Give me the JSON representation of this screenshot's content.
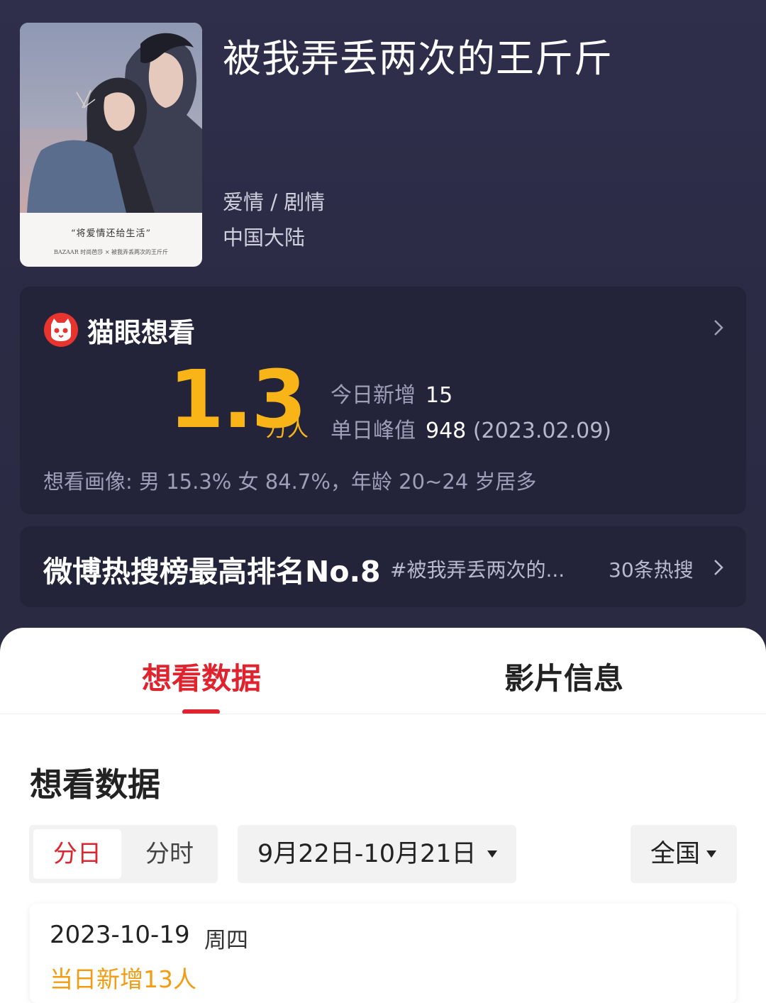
{
  "movie": {
    "title": "被我弄丢两次的王斤斤",
    "genre": "爱情 / 剧情",
    "region": "中国大陆",
    "poster": {
      "caption": "“将爱情还给生活”",
      "logos": "BAZAAR 时尚芭莎 × 被我弄丢两次的王斤斤"
    }
  },
  "want_card": {
    "title": "猫眼想看",
    "total_value": "1.3",
    "total_unit": "万人",
    "today_label": "今日新增",
    "today_value": "15",
    "peak_label": "单日峰值",
    "peak_value": "948",
    "peak_date": "(2023.02.09)",
    "portrait": "想看画像: 男 15.3%  女 84.7%，年龄 20~24 岁居多"
  },
  "weibo": {
    "rank_text": "微博热搜榜最高排名No.8",
    "tag": "#被我弄丢两次的...",
    "count": "30条热搜"
  },
  "tabs": [
    {
      "label": "想看数据",
      "active": true
    },
    {
      "label": "影片信息",
      "active": false
    }
  ],
  "section": {
    "title": "想看数据",
    "segments": [
      {
        "label": "分日",
        "active": true
      },
      {
        "label": "分时",
        "active": false
      }
    ],
    "date_range": "9月22日-10月21日",
    "region_filter": "全国"
  },
  "daily_entry": {
    "date": "2023-10-19",
    "weekday": "周四",
    "added": "当日新增13人"
  },
  "colors": {
    "accent_red": "#e0242f",
    "gold": "#f9b518",
    "orange": "#f39c12",
    "top_background": "#2b2b45"
  }
}
